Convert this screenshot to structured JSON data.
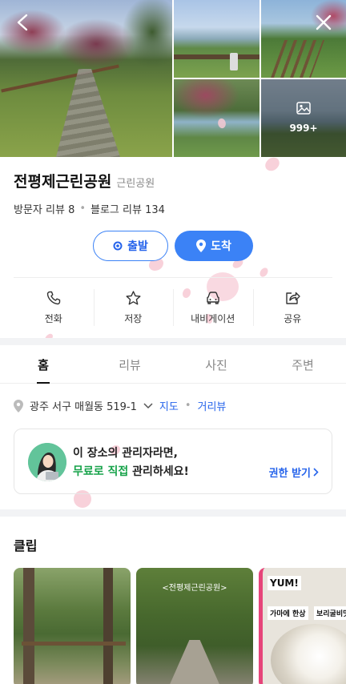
{
  "gallery": {
    "more_count": "999+"
  },
  "place": {
    "name": "전평제근린공원",
    "category": "근린공원",
    "visitor_reviews": "방문자 리뷰 8",
    "blog_reviews": "블로그 리뷰 134"
  },
  "route": {
    "start_label": "출발",
    "arrive_label": "도착"
  },
  "actions": [
    {
      "label": "전화",
      "icon": "phone-icon"
    },
    {
      "label": "저장",
      "icon": "star-icon"
    },
    {
      "label": "내비게이션",
      "icon": "car-icon"
    },
    {
      "label": "공유",
      "icon": "share-icon"
    }
  ],
  "tabs": [
    {
      "label": "홈",
      "active": true
    },
    {
      "label": "리뷰",
      "active": false
    },
    {
      "label": "사진",
      "active": false
    },
    {
      "label": "주변",
      "active": false
    }
  ],
  "address": {
    "text": "광주 서구 매월동 519-1",
    "map_link": "지도",
    "street_view_link": "거리뷰"
  },
  "owner_card": {
    "line1": "이 장소의 관리자라면,",
    "line2_highlight": "무료로 직접",
    "line2_rest": " 관리하세요!",
    "claim_label": "권한 받기"
  },
  "clips": {
    "title": "클립",
    "items": [
      {
        "caption": ""
      },
      {
        "caption": "<전평제근린공원>"
      },
      {
        "badge": "YUM!",
        "tag1": "가마에 한상",
        "tag2": "보리굴비맛"
      }
    ]
  },
  "colors": {
    "accent": "#3b82f6",
    "highlight_green": "#17a34a",
    "petal": "#f7c9d4"
  }
}
